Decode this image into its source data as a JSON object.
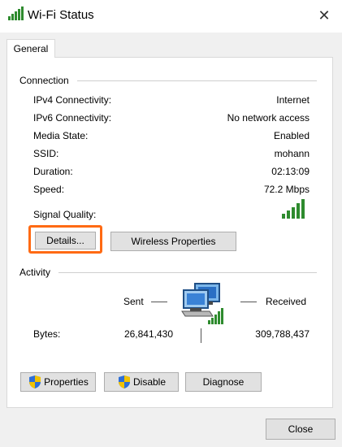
{
  "window": {
    "title": "Wi-Fi Status",
    "close_glyph": "✕",
    "icon": "wifi-signal-icon"
  },
  "tabs": [
    {
      "label": "General",
      "selected": true
    }
  ],
  "connection": {
    "group_label": "Connection",
    "rows": [
      {
        "label": "IPv4 Connectivity:",
        "value": "Internet"
      },
      {
        "label": "IPv6 Connectivity:",
        "value": "No network access"
      },
      {
        "label": "Media State:",
        "value": "Enabled"
      },
      {
        "label": "SSID:",
        "value": "mohann"
      },
      {
        "label": "Duration:",
        "value": "02:13:09"
      },
      {
        "label": "Speed:",
        "value": "72.2 Mbps"
      }
    ],
    "signal_quality_label": "Signal Quality:",
    "signal_bars": 5,
    "details_button": "Details...",
    "wireless_properties_button": "Wireless Properties"
  },
  "activity": {
    "group_label": "Activity",
    "sent_label": "Sent",
    "received_label": "Received",
    "bytes_label": "Bytes:",
    "bytes_sent": "26,841,430",
    "bytes_received": "309,788,437"
  },
  "actions": {
    "properties_button": "Properties",
    "disable_button": "Disable",
    "diagnose_button": "Diagnose"
  },
  "footer": {
    "close_button": "Close"
  },
  "colors": {
    "signal_green": "#2e8b2e",
    "highlight_orange": "#ff6a13",
    "shield_blue": "#2f6fd6",
    "shield_yellow": "#f2c200"
  }
}
